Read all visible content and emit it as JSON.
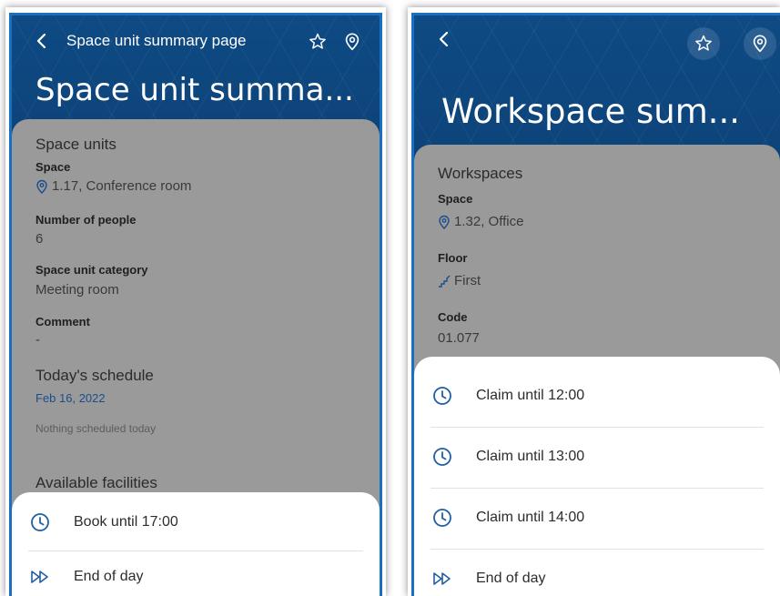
{
  "colors": {
    "header_blue": "#0f4a82",
    "frame_blue": "#1b6fc0",
    "content_gray": "#9a9a9a",
    "link_blue": "#1a4e8a",
    "sheet_white": "#ffffff",
    "icon_blue": "#1f5fa3"
  },
  "left": {
    "header": {
      "title": "Space unit summary page",
      "big_title": "Space unit summa...",
      "icons": [
        "chevron-left-icon",
        "star-outline-icon",
        "location-pin-icon"
      ]
    },
    "details": {
      "section_title": "Space units",
      "space_label": "Space",
      "space_value": "1.17, Conference room",
      "people_label": "Number of people",
      "people_value": "6",
      "category_label": "Space unit category",
      "category_value": "Meeting room",
      "comment_label": "Comment",
      "comment_value": "-",
      "schedule_title": "Today's schedule",
      "schedule_date": "Feb 16, 2022",
      "schedule_empty": "Nothing scheduled today",
      "facilities_title": "Available facilities"
    },
    "sheet": {
      "items": [
        {
          "label": "Book until 17:00",
          "icon": "clock-icon"
        },
        {
          "label": "End of day",
          "icon": "fast-forward-icon"
        }
      ]
    }
  },
  "right": {
    "header": {
      "big_title": "Workspace sum...",
      "icons": [
        "chevron-left-icon",
        "star-outline-icon",
        "location-pin-icon"
      ]
    },
    "details": {
      "section_title": "Workspaces",
      "space_label": "Space",
      "space_value": "1.32, Office",
      "floor_label": "Floor",
      "floor_value": "First",
      "code_label": "Code",
      "code_value": "01.077"
    },
    "sheet": {
      "items": [
        {
          "label": "Claim until 12:00",
          "icon": "clock-icon"
        },
        {
          "label": "Claim until 13:00",
          "icon": "clock-icon"
        },
        {
          "label": "Claim until 14:00",
          "icon": "clock-icon"
        },
        {
          "label": "End of day",
          "icon": "fast-forward-icon"
        }
      ]
    }
  }
}
